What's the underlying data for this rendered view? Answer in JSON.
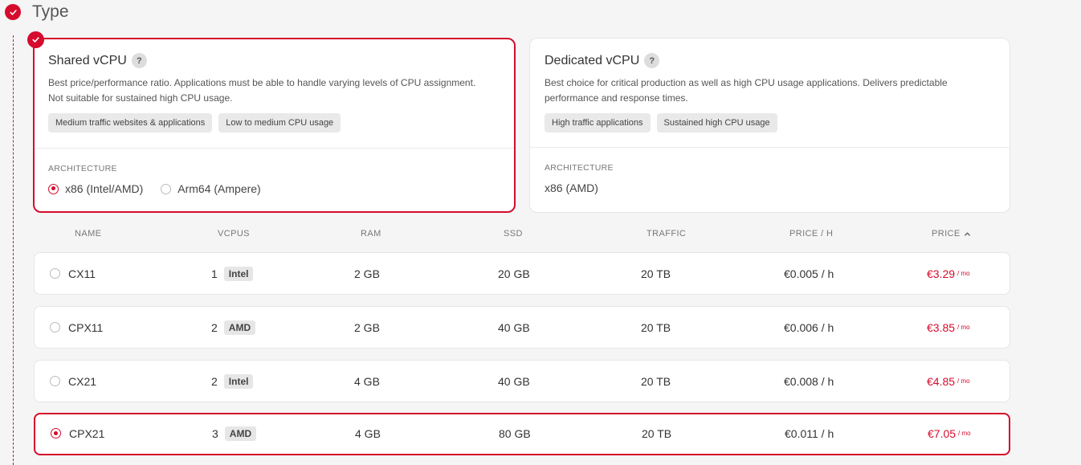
{
  "section": {
    "title": "Type"
  },
  "types": [
    {
      "title": "Shared vCPU",
      "help": "?",
      "description": "Best price/performance ratio. Applications must be able to handle varying levels of CPU assignment. Not suitable for sustained high CPU usage.",
      "tags": [
        "Medium traffic websites & applications",
        "Low to medium CPU usage"
      ],
      "architecture_label": "ARCHITECTURE",
      "architecture_options": [
        "x86 (Intel/AMD)",
        "Arm64 (Ampere)"
      ],
      "selected_architecture": "x86 (Intel/AMD)",
      "selected": true
    },
    {
      "title": "Dedicated vCPU",
      "help": "?",
      "description": "Best choice for critical production as well as high CPU usage applications. Delivers predictable performance and response times.",
      "tags": [
        "High traffic applications",
        "Sustained high CPU usage"
      ],
      "architecture_label": "ARCHITECTURE",
      "architecture_value": "x86 (AMD)",
      "selected": false
    }
  ],
  "table": {
    "headers": {
      "name": "NAME",
      "vcpus": "VCPUS",
      "ram": "RAM",
      "ssd": "SSD",
      "traffic": "TRAFFIC",
      "price_h": "PRICE / H",
      "price": "PRICE"
    },
    "sort_indicator": "chevron-up-icon",
    "rows": [
      {
        "name": "CX11",
        "vcpus": "1",
        "cpu": "Intel",
        "ram": "2 GB",
        "ssd": "20 GB",
        "traffic": "20 TB",
        "price_h": "€0.005 / h",
        "price": "€3.29",
        "unit": "/ mo",
        "selected": false
      },
      {
        "name": "CPX11",
        "vcpus": "2",
        "cpu": "AMD",
        "ram": "2 GB",
        "ssd": "40 GB",
        "traffic": "20 TB",
        "price_h": "€0.006 / h",
        "price": "€3.85",
        "unit": "/ mo",
        "selected": false
      },
      {
        "name": "CX21",
        "vcpus": "2",
        "cpu": "Intel",
        "ram": "4 GB",
        "ssd": "40 GB",
        "traffic": "20 TB",
        "price_h": "€0.008 / h",
        "price": "€4.85",
        "unit": "/ mo",
        "selected": false
      },
      {
        "name": "CPX21",
        "vcpus": "3",
        "cpu": "AMD",
        "ram": "4 GB",
        "ssd": "80 GB",
        "traffic": "20 TB",
        "price_h": "€0.011 / h",
        "price": "€7.05",
        "unit": "/ mo",
        "selected": true
      }
    ]
  },
  "colors": {
    "accent": "#d50c2d"
  }
}
